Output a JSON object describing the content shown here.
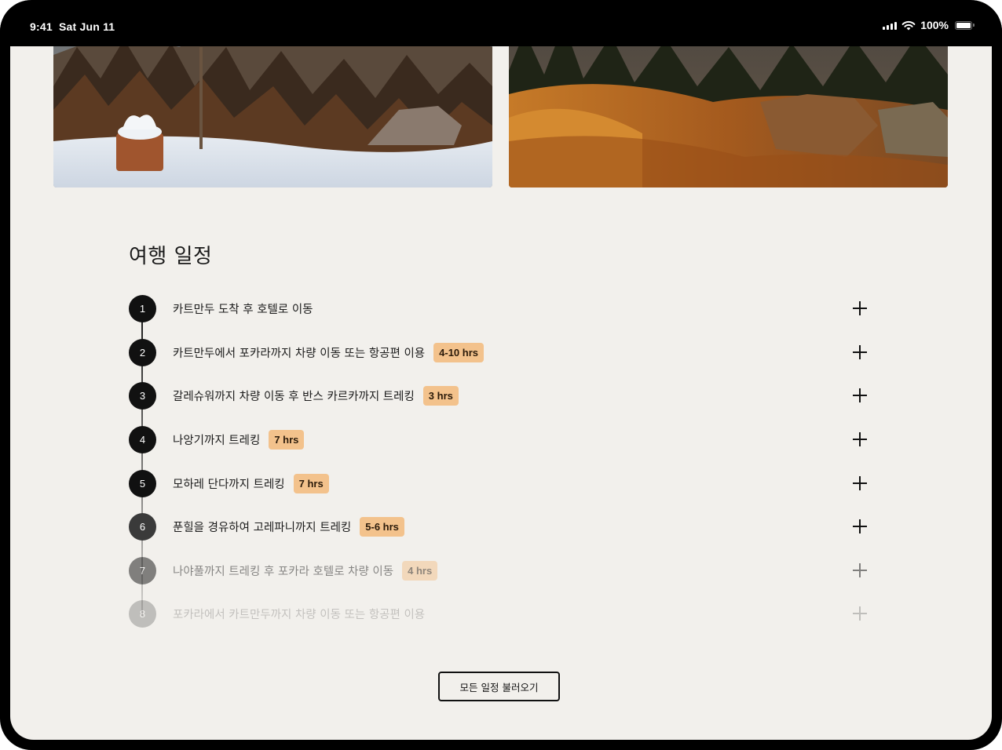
{
  "status_bar": {
    "time": "9:41",
    "date": "Sat Jun 11",
    "battery": "100%"
  },
  "images": [
    {
      "name": "snowy-forest-photo",
      "icon": "landscape-snow"
    },
    {
      "name": "golden-grass-forest-photo",
      "icon": "landscape-golden-grass"
    }
  ],
  "itinerary": {
    "title": "여행 일정",
    "items": [
      {
        "num": "1",
        "label": "카트만두 도착 후 호텔로 이동",
        "duration": ""
      },
      {
        "num": "2",
        "label": "카트만두에서 포카라까지 차량 이동 또는 항공편 이용",
        "duration": "4-10 hrs"
      },
      {
        "num": "3",
        "label": "갈레슈워까지 차량 이동 후 반스 카르카까지 트레킹",
        "duration": "3 hrs"
      },
      {
        "num": "4",
        "label": "나앙기까지 트레킹",
        "duration": "7 hrs"
      },
      {
        "num": "5",
        "label": "모하레 단다까지 트레킹",
        "duration": "7 hrs"
      },
      {
        "num": "6",
        "label": "푼힐을 경유하여 고레파니까지 트레킹",
        "duration": "5-6 hrs"
      },
      {
        "num": "7",
        "label": "나야풀까지 트레킹 후 포카라 호텔로 차량 이동",
        "duration": "4 hrs"
      },
      {
        "num": "8",
        "label": "포카라에서 카트만두까지 차량 이동 또는 항공편 이용",
        "duration": ""
      }
    ],
    "load_all_label": "모든 일정 불러오기"
  },
  "colors": {
    "background": "#f2f0ec",
    "badge": "#f3c28c",
    "text": "#1c1c1c"
  }
}
